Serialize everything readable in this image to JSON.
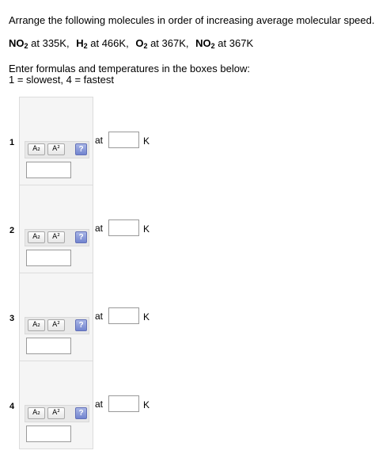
{
  "prompt": "Arrange the following molecules in order of increasing average molecular speed.",
  "given": [
    {
      "formula": "NO",
      "sub": "2",
      "at": " at ",
      "temp": "335K",
      "sep": ","
    },
    {
      "formula": "H",
      "sub": "2",
      "at": " at ",
      "temp": "466K",
      "sep": ","
    },
    {
      "formula": "O",
      "sub": "2",
      "at": " at ",
      "temp": "367K",
      "sep": ","
    },
    {
      "formula": "NO",
      "sub": "2",
      "at": " at ",
      "temp": "367K",
      "sep": ""
    }
  ],
  "instructions": {
    "line1": "Enter formulas and temperatures in the boxes below:",
    "line2": "1 = slowest, 4 = fastest"
  },
  "rows": [
    {
      "number": "1",
      "subscript_label": "A₂",
      "superscript_label": "A²",
      "help_label": "?",
      "at_label": "at",
      "unit": "K",
      "formula_value": "",
      "temp_value": ""
    },
    {
      "number": "2",
      "subscript_label": "A₂",
      "superscript_label": "A²",
      "help_label": "?",
      "at_label": "at",
      "unit": "K",
      "formula_value": "",
      "temp_value": ""
    },
    {
      "number": "3",
      "subscript_label": "A₂",
      "superscript_label": "A²",
      "help_label": "?",
      "at_label": "at",
      "unit": "K",
      "formula_value": "",
      "temp_value": ""
    },
    {
      "number": "4",
      "subscript_label": "A₂",
      "superscript_label": "A²",
      "help_label": "?",
      "at_label": "at",
      "unit": "K",
      "formula_value": "",
      "temp_value": ""
    }
  ]
}
